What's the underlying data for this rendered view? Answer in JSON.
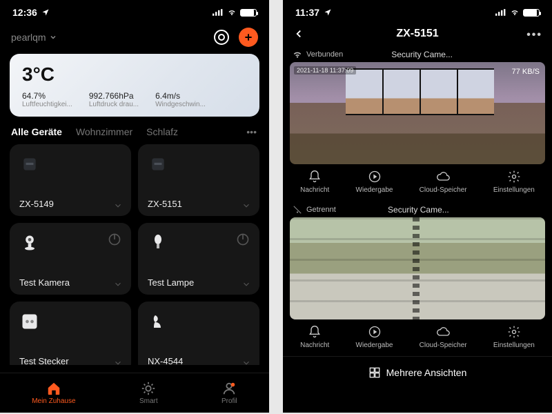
{
  "left": {
    "status": {
      "time": "12:36"
    },
    "header": {
      "home_name": "pearlqm"
    },
    "weather": {
      "temp": "3°C",
      "items": [
        {
          "val": "64.7%",
          "lab": "Luftfeuchtigkei..."
        },
        {
          "val": "992.766hPa",
          "lab": "Luftdruck drau..."
        },
        {
          "val": "6.4m/s",
          "lab": "Windgeschwin..."
        }
      ]
    },
    "tabs": {
      "all": "Alle Geräte",
      "t1": "Wohnzimmer",
      "t2": "Schlafz"
    },
    "devices": [
      {
        "name": "ZX-5149"
      },
      {
        "name": "ZX-5151"
      },
      {
        "name": "Test Kamera"
      },
      {
        "name": "Test Lampe"
      },
      {
        "name": "Test Stecker"
      },
      {
        "name": "NX-4544"
      }
    ],
    "nav": {
      "home": "Mein Zuhause",
      "smart": "Smart",
      "profile": "Profil"
    }
  },
  "right": {
    "status": {
      "time": "11:37"
    },
    "title": "ZX-5151",
    "cam1": {
      "status": "Verbunden",
      "title": "Security Came...",
      "timestamp": "2021-11-18 11:37:09",
      "bitrate": "77 KB/S"
    },
    "cam2": {
      "status": "Getrennt",
      "title": "Security Came..."
    },
    "actions": {
      "msg": "Nachricht",
      "play": "Wiedergabe",
      "cloud": "Cloud-Speicher",
      "set": "Einstellungen"
    },
    "multi_views": "Mehrere Ansichten"
  }
}
